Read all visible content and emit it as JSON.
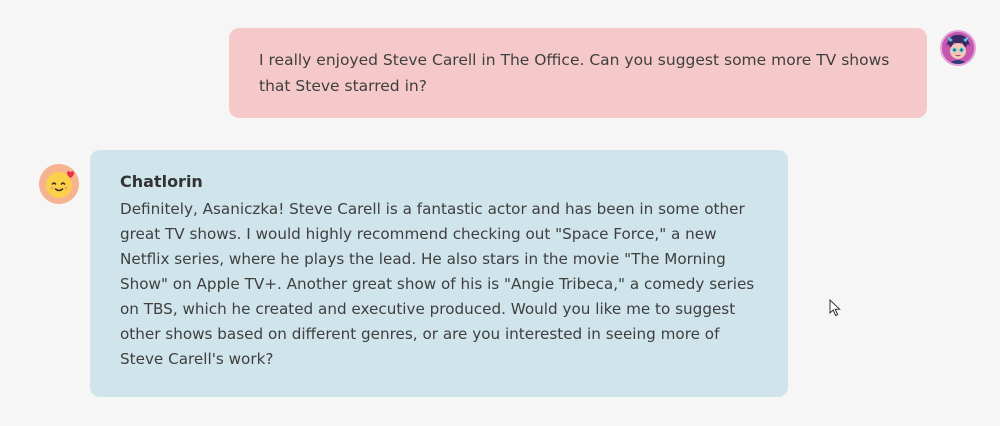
{
  "conversation": {
    "user_message": {
      "text": "I really enjoyed Steve Carell in The Office. Can you suggest some more TV shows that Steve starred in?",
      "avatar_icon": "user-avatar-illustration",
      "bubble_color": "#f5c9ca"
    },
    "bot_message": {
      "sender": "Chatlorin",
      "text": "Definitely, Asaniczka! Steve Carell is a fantastic actor and has been in some other great TV shows. I would highly recommend checking out \"Space Force,\" a new Netflix series, where he plays the lead. He also stars in the movie \"The Morning Show\" on Apple TV+. Another great show of his is \"Angie Tribeca,\" a comedy series on TBS, which he created and executive produced. Would you like me to suggest other shows based on different genres, or are you interested in seeing more of Steve Carell's work?",
      "avatar_icon": "smiling-face-with-heart-icon",
      "bubble_color": "#cfe4eb"
    }
  },
  "cursor_icon": "mouse-pointer-icon"
}
